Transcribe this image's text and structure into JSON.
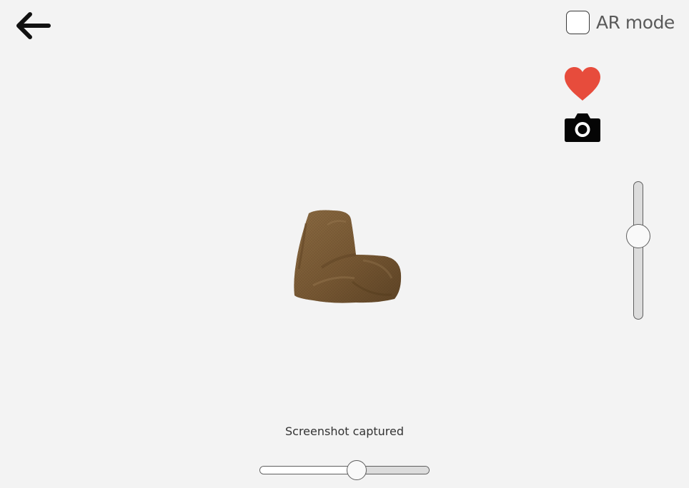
{
  "app": {
    "background": "#f3f3f3"
  },
  "nav": {
    "back_icon": "arrow-left-icon"
  },
  "ar_mode": {
    "label": "AR mode",
    "checked": false
  },
  "actions": {
    "favorite_icon": "heart-icon",
    "favorite_color": "#e74c3c",
    "screenshot_icon": "camera-icon"
  },
  "model": {
    "object": "bean-bag-chair",
    "color": "#7a5a36"
  },
  "zoom_slider": {
    "orientation": "vertical",
    "value": 0.63
  },
  "status": {
    "message": "Screenshot captured"
  },
  "rotation_slider": {
    "orientation": "horizontal",
    "value": 0.58
  }
}
